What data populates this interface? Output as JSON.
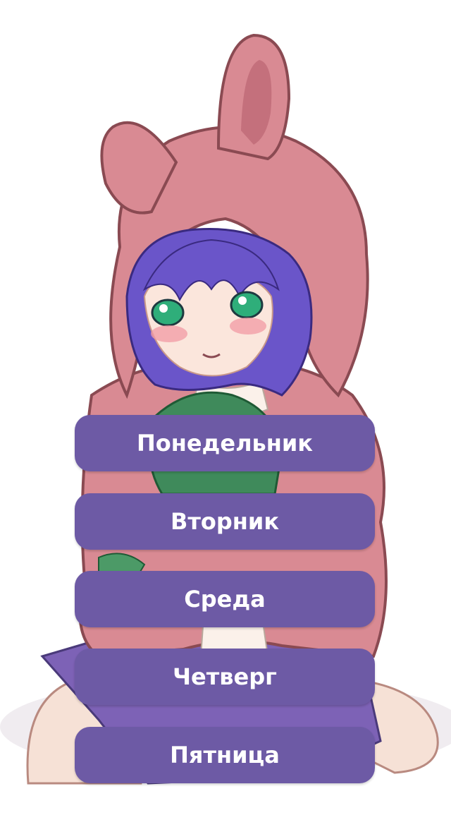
{
  "background": {
    "image_icon": "anime-girl-bunny-hood-illustration",
    "colors": {
      "hood": "#d98a93",
      "hair": "#6a55c9",
      "eyes": "#2fae7a",
      "button": "#6d5aa5",
      "button_text": "#ffffff"
    }
  },
  "menu": {
    "days": [
      {
        "label": "Понедельник"
      },
      {
        "label": "Вторник"
      },
      {
        "label": "Среда"
      },
      {
        "label": "Четверг"
      },
      {
        "label": "Пятница"
      }
    ]
  }
}
